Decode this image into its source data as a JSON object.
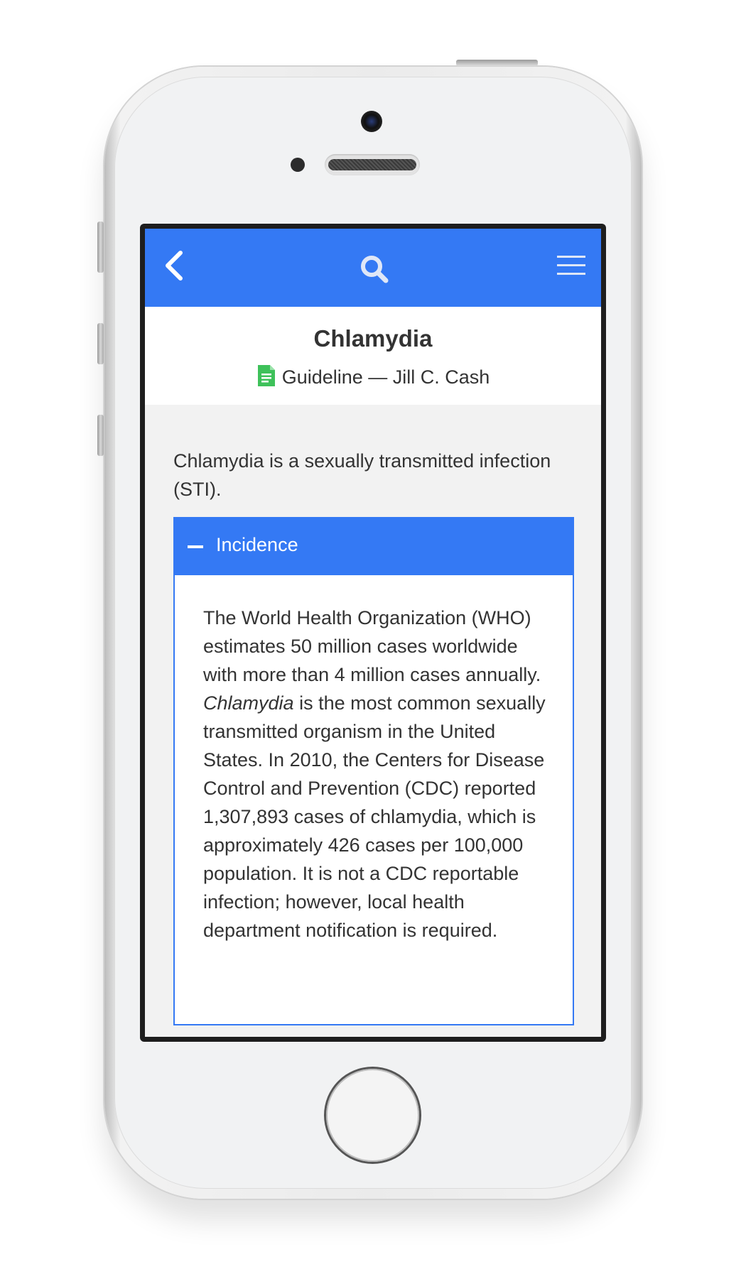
{
  "app": {
    "toolbar": {
      "back_icon": "chevron-left-icon",
      "search_icon": "search-icon",
      "menu_icon": "hamburger-menu-icon",
      "bar_color": "#3479f4"
    },
    "header": {
      "title": "Chlamydia",
      "doc_icon": "document-icon",
      "doc_icon_color": "#3ec15a",
      "subtitle": "Guideline — Jill C. Cash"
    },
    "intro": "Chlamydia is a sexually transmitted infection (STI).",
    "section": {
      "toggle_icon": "minus-icon",
      "title": "Incidence",
      "body_part1": "The World Health Organization (WHO) estimates 50 million cases worldwide with more than 4 million cases annually. ",
      "body_italic": "Chlamydia",
      "body_part2": " is the most common sexually transmitted organism in the United States. In 2010, the Centers for Disease Control and Prevention (CDC) reported 1,307,893 cases of chlamydia, which is approximately 426 cases per 100,000 population. It is not a CDC reportable infection; however, local health department notification is required."
    }
  }
}
